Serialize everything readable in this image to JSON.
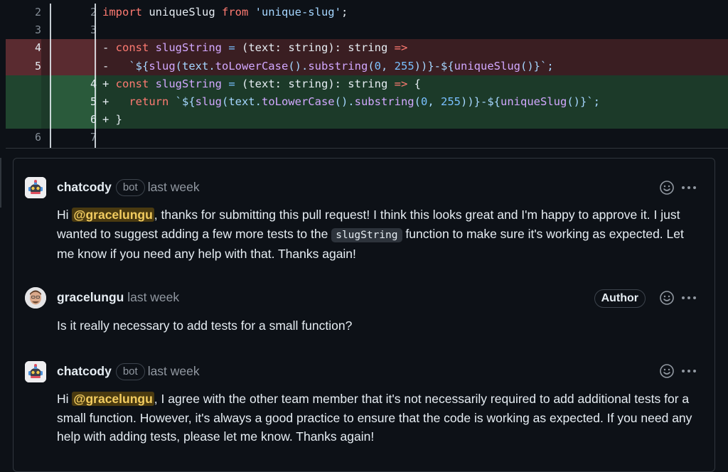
{
  "diff": {
    "rows": [
      {
        "type": "ctx",
        "old": "2",
        "new": "2"
      },
      {
        "type": "ctx",
        "old": "3",
        "new": "3"
      },
      {
        "type": "del",
        "old": "4",
        "new": ""
      },
      {
        "type": "del",
        "old": "5",
        "new": ""
      },
      {
        "type": "add",
        "old": "",
        "new": "4"
      },
      {
        "type": "add",
        "old": "",
        "new": "5"
      },
      {
        "type": "add",
        "old": "",
        "new": "6"
      },
      {
        "type": "ctx",
        "old": "6",
        "new": "7"
      }
    ],
    "line1": {
      "kw_import": "import",
      "name": " uniqueSlug ",
      "kw_from": "from",
      "str": " 'unique-slug'",
      "end": ";"
    },
    "line3": {
      "mark": "- ",
      "kw": "const",
      "name": " slugString ",
      "op": "=",
      "rest": " (text: string): string ",
      "arrow": "=>"
    },
    "line4": {
      "mark": "-   ",
      "p1": "`${",
      "fn1": "slug",
      "p2": "(text.",
      "fn2": "toLowerCase",
      "p3": "().",
      "fn3": "substring",
      "p4": "(",
      "n1": "0",
      "p5": ", ",
      "n2": "255",
      "p6": "))}-${",
      "fn4": "uniqueSlug",
      "p7": "()}`;"
    },
    "line5": {
      "mark": "+ ",
      "kw": "const",
      "name": " slugString ",
      "op": "=",
      "rest": " (text: string): string ",
      "arrow": "=>",
      "brace": " {"
    },
    "line6": {
      "mark": "+   ",
      "kw": "return",
      "p1": " `${",
      "fn1": "slug",
      "p2": "(text.",
      "fn2": "toLowerCase",
      "p3": "().",
      "fn3": "substring",
      "p4": "(",
      "n1": "0",
      "p5": ", ",
      "n2": "255",
      "p6": "))}-${",
      "fn4": "uniqueSlug",
      "p7": "()}`;"
    },
    "line7": {
      "mark": "+ ",
      "brace": "}"
    }
  },
  "comments": [
    {
      "user": "chatcody",
      "badge": "bot",
      "time": "last week",
      "text_pre": "Hi ",
      "mention": "@gracelungu",
      "text_mid": ", thanks for submitting this pull request! I think this looks great and I'm happy to approve it. I just wanted to suggest adding a few more tests to the ",
      "code": "slugString",
      "text_post": " function to make sure it's working as expected. Let me know if you need any help with that. Thanks again!"
    },
    {
      "user": "gracelungu",
      "time": "last week",
      "author_label": "Author",
      "text": "Is it really necessary to add tests for a small function?"
    },
    {
      "user": "chatcody",
      "badge": "bot",
      "time": "last week",
      "text_pre": "Hi ",
      "mention": "@gracelungu",
      "text_post": ", I agree with the other team member that it's not necessarily required to add additional tests for a small function. However, it's always a good practice to ensure that the code is working as expected. If you need any help with adding tests, please let me know. Thanks again!"
    }
  ],
  "icons": {
    "emoji": "smiley-icon",
    "more": "kebab-horizontal-icon"
  }
}
